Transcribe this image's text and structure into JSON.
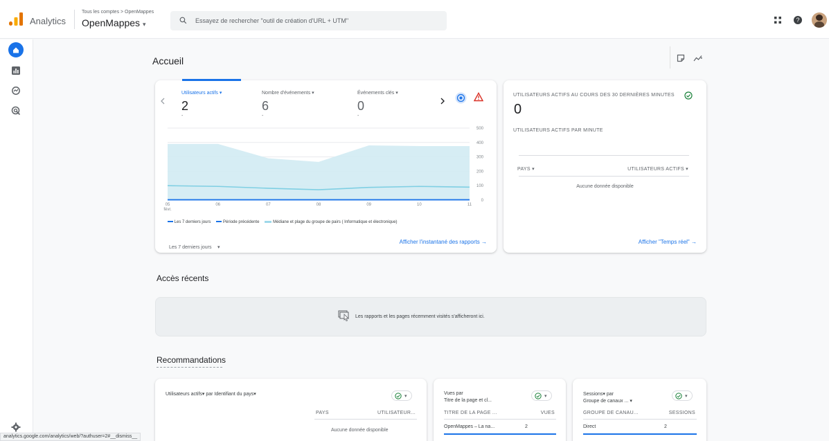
{
  "header": {
    "app_name": "Analytics",
    "breadcrumb": "Tous les comptes > OpenMappes",
    "property_name": "OpenMappes",
    "property_caret": "▾",
    "search_placeholder": "Essayez de rechercher \"outil de création d'URL + UTM\""
  },
  "page": {
    "title": "Accueil",
    "recent_title": "Accès récents",
    "recent_empty": "Les rapports et les pages récemment visités s'afficheront ici.",
    "recommendations_title": "Recommandations"
  },
  "overview": {
    "metrics": [
      {
        "label": "Utilisateurs actifs ▾",
        "value": "2",
        "sub": "-"
      },
      {
        "label": "Nombre d'événements ▾",
        "value": "6",
        "sub": "-"
      },
      {
        "label": "Événements clés ▾",
        "value": "0",
        "sub": "-"
      }
    ],
    "legend": [
      {
        "label": "Les 7 derniers jours"
      },
      {
        "label": "Période précédente"
      },
      {
        "label": "Médiane et plage du groupe de pairs ( Informatique et électronique)"
      }
    ],
    "period_select": "Les 7 derniers jours",
    "period_caret": "▾",
    "link": "Afficher l'instantané des rapports →"
  },
  "chart_data": {
    "type": "line",
    "x": [
      "05 févr.",
      "06",
      "07",
      "08",
      "09",
      "10",
      "11"
    ],
    "x_tick_top": [
      "05",
      "06",
      "07",
      "08",
      "09",
      "10",
      "11"
    ],
    "x_tick_month": "févr.",
    "yticks": [
      "500",
      "400",
      "300",
      "200",
      "100",
      "0"
    ],
    "ylim": [
      0,
      500
    ],
    "series": [
      {
        "name": "Les 7 derniers jours",
        "values": [
          2,
          2,
          2,
          2,
          2,
          2,
          2
        ]
      },
      {
        "name": "Médiane et plage du groupe de pairs ( Informatique et électronique)",
        "values": [
          100,
          95,
          82,
          72,
          88,
          95,
          90
        ]
      }
    ],
    "band": {
      "upper": [
        390,
        390,
        290,
        265,
        380,
        375,
        375
      ],
      "lower": [
        0,
        0,
        0,
        0,
        0,
        0,
        0
      ]
    },
    "colors": {
      "current": "#1a73e8",
      "band": "#d2ebf3",
      "median": "#7fcfe3"
    }
  },
  "realtime": {
    "title": "UTILISATEURS ACTIFS AU COURS DES 30 DERNIÈRES MINUTES",
    "value": "0",
    "per_minute": "UTILISATEURS ACTIFS PAR MINUTE",
    "col_country": "PAYS ▾",
    "col_users": "UTILISATEURS ACTIFS ▾",
    "no_data": "Aucune donnée disponible",
    "link": "Afficher \"Temps réel\" →"
  },
  "rec_cards": [
    {
      "title": "Utilisateurs actifs▾ par Identifiant du pays▾",
      "col1": "PAYS",
      "col2": "UTILISATEUR...",
      "no_data": "Aucune donnée disponible"
    },
    {
      "title_line1": "Vues par",
      "title_line2": "Titre de la page et cl...",
      "col1": "TITRE DE LA PAGE ...",
      "col2": "VUES",
      "row_label": "OpenMappes – La na...",
      "row_value": "2"
    },
    {
      "title_line1": "Sessions▾ par",
      "title_line2": "Groupe de canaux ... ▾",
      "col1": "GROUPE DE CANAU...",
      "col2": "SESSIONS",
      "row_label": "Direct",
      "row_value": "2"
    }
  ],
  "chip_caret": "▾",
  "status_url": "analytics.google.com/analytics/web/?authuser=2#__dismiss__",
  "colors": {
    "accent": "#1a73e8",
    "logo_orange": "#f9ab00",
    "logo_dark": "#e37400",
    "alert": "#d93025",
    "ok": "#188038"
  }
}
